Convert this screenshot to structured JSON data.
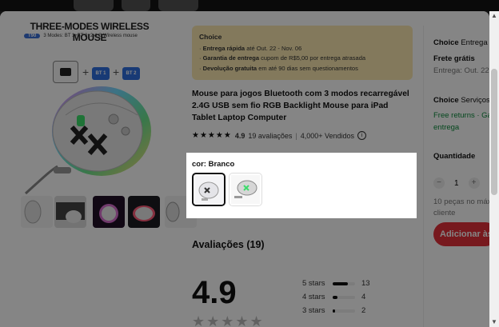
{
  "product": {
    "image_title": "THREE-MODES WIRELESS MOUSE",
    "image_badge": "T90",
    "image_subtitle": "3 Modes: BT 1+BT 2+2.4 G Wireless mouse",
    "bt1": "BT 1",
    "bt2": "BT 2",
    "title": "Mouse para jogos Bluetooth com 3 modos recarregável 2.4G USB sem fio RGB Backlight Mouse para iPad Tablet Laptop Computer",
    "rating": "4.9",
    "reviews_link": "19 avaliações",
    "sold": "4,000+ Vendidos",
    "stars": "★★★★★"
  },
  "choice_box": {
    "heading": "Choice",
    "lines": [
      {
        "bold": "Entrega rápida",
        "rest": " até Out. 22 - Nov. 06"
      },
      {
        "bold": "Garantia de entrega",
        "rest": "  cupom de R$5,00 por entrega atrasada"
      },
      {
        "bold": "Devolução gratuita",
        "rest": "  em até 90 dias sem questionamentos"
      }
    ]
  },
  "color": {
    "label": "cor: Branco",
    "options": [
      "Branco",
      "Cinza"
    ]
  },
  "reviews": {
    "heading": "Avaliações (19)",
    "score": "4.9",
    "stars": "★★★★★",
    "breakdown": [
      {
        "label": "5 stars",
        "count": "13",
        "fraction": 0.68
      },
      {
        "label": "4 stars",
        "count": "4",
        "fraction": 0.21
      },
      {
        "label": "3 stars",
        "count": "2",
        "fraction": 0.11
      }
    ]
  },
  "side": {
    "choice_title": "Choice",
    "choice_sub": " Entrega",
    "free_shipping": "Frete grátis",
    "delivery": "Entrega: Out. 22",
    "services_title": "Choice",
    "services_sub": " Serviços",
    "free_returns": "Free returns · Ga",
    "entrega": "entrega",
    "quantity_label": "Quantidade",
    "quantity_value": "1",
    "stock_line1": "10 peças no máx",
    "stock_line2": "cliente",
    "add_button": "Adicionar às"
  },
  "colors": {
    "accent_red": "#e4303b",
    "choice_bg": "#fbe9b0",
    "rgb_green": "#3cdc6a"
  }
}
